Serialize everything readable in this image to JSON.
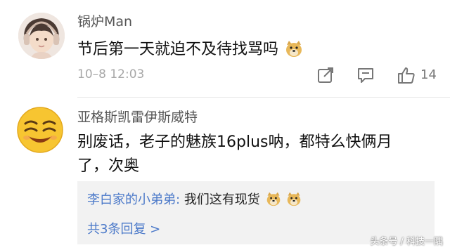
{
  "comment1": {
    "username": "锅炉Man",
    "text": "节后第一天就迫不及待找骂吗",
    "time": "10–8 12:03",
    "like_count": "14"
  },
  "comment2": {
    "username": "亚格斯凯雷伊斯威特",
    "text": "别废话，老子的魅族16plus呐，都特么快俩月了，次奥"
  },
  "reply": {
    "author": "李白家的小弟弟:",
    "text": "我们这有现货",
    "more_label": "共3条回复 >"
  },
  "watermark": "头条号 / 科技一隅",
  "icons": [
    "share-icon",
    "comment-icon",
    "thumbs-up-icon",
    "doge-emoji",
    "smiley-avatar"
  ],
  "colors": {
    "link": "#4b79c9",
    "meta": "#a8a8a8",
    "reply_bg": "#f2f2f2"
  }
}
